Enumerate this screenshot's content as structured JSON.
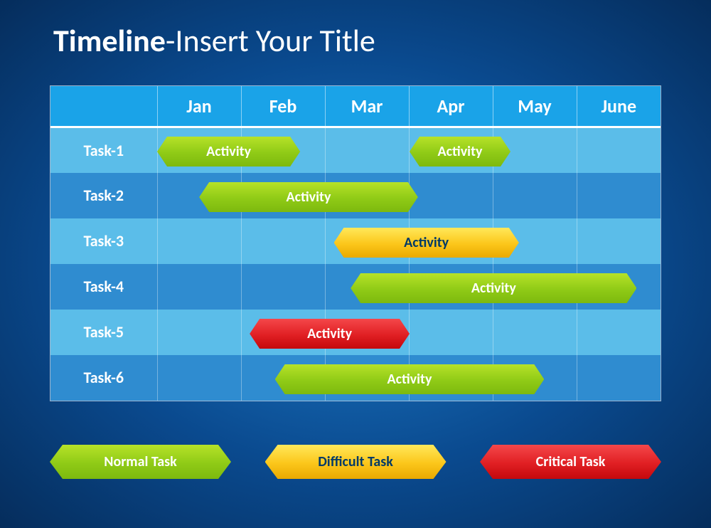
{
  "title_bold": "Timeline",
  "title_rest": "-Insert Your Title",
  "months": [
    "Jan",
    "Feb",
    "Mar",
    "Apr",
    "May",
    "June"
  ],
  "tasks": [
    "Task-1",
    "Task-2",
    "Task-3",
    "Task-4",
    "Task-5",
    "Task-6"
  ],
  "legend": {
    "normal": "Normal Task",
    "difficult": "Difficult Task",
    "critical": "Critical Task"
  },
  "colors": {
    "normal": "#8fca16",
    "difficult": "#fbc61a",
    "critical": "#e01f23"
  },
  "chart_data": {
    "type": "bar",
    "title": "Timeline-Insert Your Title",
    "xlabel": "",
    "ylabel": "",
    "categories": [
      "Jan",
      "Feb",
      "Mar",
      "Apr",
      "May",
      "June"
    ],
    "rows": [
      "Task-1",
      "Task-2",
      "Task-3",
      "Task-4",
      "Task-5",
      "Task-6"
    ],
    "bars": [
      {
        "row": 0,
        "start": 0.0,
        "end": 1.7,
        "label": "Activity",
        "kind": "normal"
      },
      {
        "row": 0,
        "start": 3.0,
        "end": 4.2,
        "label": "Activity",
        "kind": "normal"
      },
      {
        "row": 1,
        "start": 0.5,
        "end": 3.1,
        "label": "Activity",
        "kind": "normal"
      },
      {
        "row": 2,
        "start": 2.1,
        "end": 4.3,
        "label": "Activity",
        "kind": "difficult"
      },
      {
        "row": 3,
        "start": 2.3,
        "end": 5.7,
        "label": "Activity",
        "kind": "normal"
      },
      {
        "row": 4,
        "start": 1.1,
        "end": 3.0,
        "label": "Activity",
        "kind": "critical"
      },
      {
        "row": 5,
        "start": 1.4,
        "end": 4.6,
        "label": "Activity",
        "kind": "normal"
      }
    ],
    "legend_kinds": {
      "normal": "Normal Task",
      "difficult": "Difficult Task",
      "critical": "Critical Task"
    }
  }
}
